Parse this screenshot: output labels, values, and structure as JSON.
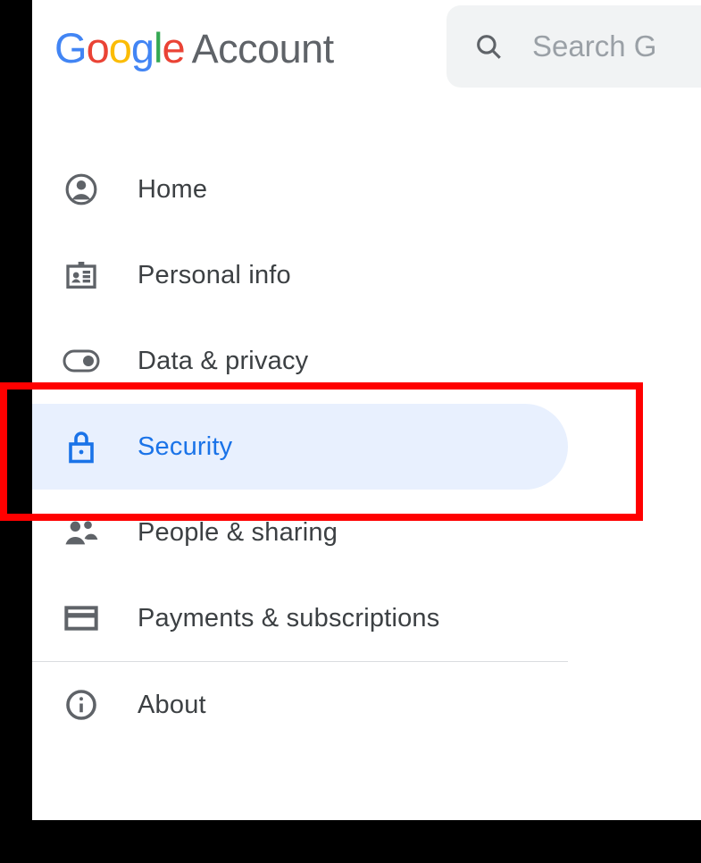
{
  "header": {
    "logo_g1": "G",
    "logo_o1": "o",
    "logo_o2": "o",
    "logo_g2": "g",
    "logo_l": "l",
    "logo_e": "e",
    "account_label": "Account"
  },
  "search": {
    "placeholder": "Search G"
  },
  "nav": {
    "items": [
      {
        "label": "Home"
      },
      {
        "label": "Personal info"
      },
      {
        "label": "Data & privacy"
      },
      {
        "label": "Security"
      },
      {
        "label": "People & sharing"
      },
      {
        "label": "Payments & subscriptions"
      },
      {
        "label": "About"
      }
    ]
  }
}
